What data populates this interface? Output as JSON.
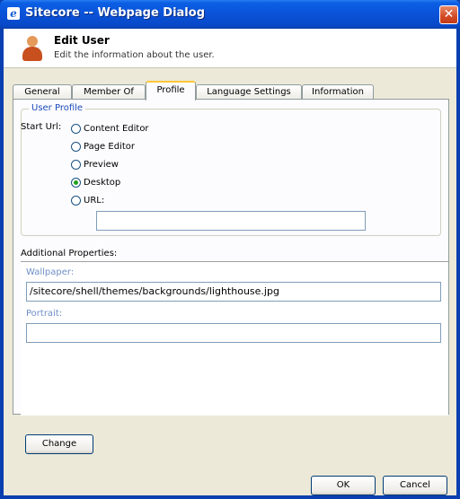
{
  "window": {
    "title": "Sitecore -- Webpage Dialog",
    "close_symbol": "✕",
    "icon": "ie-icon"
  },
  "header": {
    "title": "Edit User",
    "subtitle": "Edit the information about the user.",
    "icon": "user-icon"
  },
  "tabs": [
    {
      "label": "General",
      "active": false
    },
    {
      "label": "Member Of",
      "active": false
    },
    {
      "label": "Profile",
      "active": true
    },
    {
      "label": "Language Settings",
      "active": false
    },
    {
      "label": "Information",
      "active": false
    }
  ],
  "profile": {
    "legend": "User Profile",
    "start_url_label": "Start Url:",
    "options": [
      {
        "label": "Content Editor",
        "checked": false
      },
      {
        "label": "Page Editor",
        "checked": false
      },
      {
        "label": "Preview",
        "checked": false
      },
      {
        "label": "Desktop",
        "checked": true
      },
      {
        "label": "URL:",
        "checked": false
      }
    ],
    "url_value": ""
  },
  "additional": {
    "label": "Additional Properties:",
    "wallpaper_label": "Wallpaper:",
    "wallpaper_value": "/sitecore/shell/themes/backgrounds/lighthouse.jpg",
    "portrait_label": "Portrait:",
    "portrait_value": ""
  },
  "buttons": {
    "change": "Change",
    "ok": "OK",
    "cancel": "Cancel"
  },
  "colors": {
    "titlebar": "#0a52d8",
    "dialog_bg": "#ece9d8",
    "active_tab_highlight": "#ffc83c",
    "legend_text": "#1a4bb8"
  }
}
